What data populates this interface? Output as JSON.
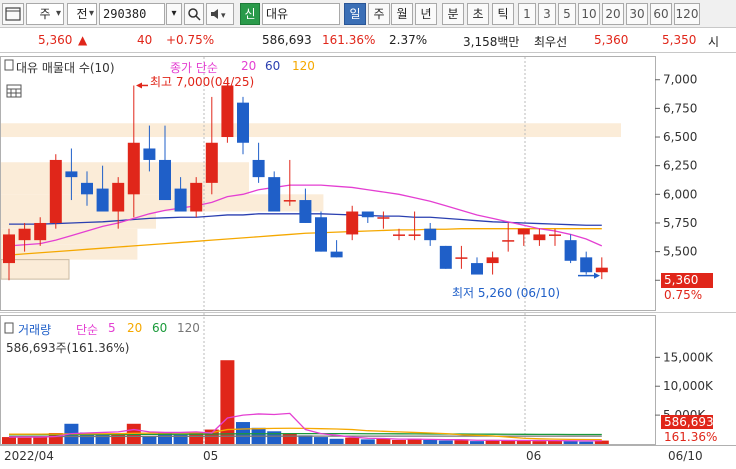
{
  "toolbar": {
    "type_label": "주",
    "market_label": "전",
    "code_value": "290380",
    "signal_badge": "신",
    "stock_name": "대유",
    "period_tabs": [
      "일",
      "주",
      "월",
      "년",
      "분",
      "초",
      "틱"
    ],
    "active_period": "일",
    "interval_buttons": [
      "1",
      "3",
      "5",
      "10",
      "20",
      "30",
      "60",
      "120"
    ]
  },
  "quote": {
    "price": "5,360",
    "change": "40",
    "change_pct": "+0.75%",
    "volume": "586,693",
    "volume_ratio": "161.36%",
    "turnover": "2.37%",
    "amount": "3,158백만",
    "ask_label": "최우선",
    "ask_price": "5,360",
    "bid_price": "5,350",
    "extra": "시"
  },
  "price_panel": {
    "title": "대유 매물대 수(10)",
    "ma_label": "종가 단순",
    "ma_periods": [
      "20",
      "60",
      "120"
    ],
    "high_annotation": "최고 7,000(04/25)",
    "low_annotation": "최저 5,260 (06/10)",
    "current_price_tag": "5,360",
    "current_pct_tag": "0.75%",
    "y_ticks": [
      "7,000",
      "6,750",
      "6,500",
      "6,250",
      "6,000",
      "5,750",
      "5,500",
      "5,250"
    ]
  },
  "volume_panel": {
    "title": "거래량",
    "ma_label": "단순",
    "ma_periods": [
      "5",
      "20",
      "60",
      "120"
    ],
    "summary": "586,693주(161.36%)",
    "current_volume_tag": "586,693",
    "current_pct_tag": "161.36%",
    "y_ticks": [
      "15,000K",
      "10,000K",
      "5,000K"
    ]
  },
  "xaxis": {
    "labels": [
      "2022/04",
      "05",
      "06",
      "06/10"
    ]
  },
  "chart_data": {
    "type": "candlestick",
    "candles": [
      {
        "o": 5400,
        "h": 5700,
        "l": 5250,
        "c": 5650
      },
      {
        "o": 5600,
        "h": 5750,
        "l": 5500,
        "c": 5700
      },
      {
        "o": 5600,
        "h": 5800,
        "l": 5550,
        "c": 5750
      },
      {
        "o": 5750,
        "h": 6350,
        "l": 5700,
        "c": 6300
      },
      {
        "o": 6200,
        "h": 6400,
        "l": 5950,
        "c": 6150
      },
      {
        "o": 6100,
        "h": 6200,
        "l": 5900,
        "c": 6000
      },
      {
        "o": 6050,
        "h": 6250,
        "l": 5850,
        "c": 5850
      },
      {
        "o": 5850,
        "h": 6150,
        "l": 5700,
        "c": 6100
      },
      {
        "o": 6000,
        "h": 6950,
        "l": 5800,
        "c": 6450
      },
      {
        "o": 6400,
        "h": 6600,
        "l": 6200,
        "c": 6300
      },
      {
        "o": 6300,
        "h": 6600,
        "l": 6000,
        "c": 5950
      },
      {
        "o": 6050,
        "h": 6150,
        "l": 5850,
        "c": 5850
      },
      {
        "o": 5850,
        "h": 6150,
        "l": 5800,
        "c": 6100
      },
      {
        "o": 6100,
        "h": 6850,
        "l": 6000,
        "c": 6450
      },
      {
        "o": 6500,
        "h": 7000,
        "l": 6450,
        "c": 6950
      },
      {
        "o": 6800,
        "h": 6850,
        "l": 6350,
        "c": 6450
      },
      {
        "o": 6300,
        "h": 6450,
        "l": 6100,
        "c": 6150
      },
      {
        "o": 6150,
        "h": 6200,
        "l": 5850,
        "c": 5850
      },
      {
        "o": 5950,
        "h": 6300,
        "l": 5900,
        "c": 5950
      },
      {
        "o": 5950,
        "h": 6050,
        "l": 5750,
        "c": 5750
      },
      {
        "o": 5800,
        "h": 5850,
        "l": 5500,
        "c": 5500
      },
      {
        "o": 5500,
        "h": 5600,
        "l": 5450,
        "c": 5450
      },
      {
        "o": 5650,
        "h": 5900,
        "l": 5600,
        "c": 5850
      },
      {
        "o": 5850,
        "h": 5850,
        "l": 5750,
        "c": 5800
      },
      {
        "o": 5800,
        "h": 5850,
        "l": 5700,
        "c": 5800
      },
      {
        "o": 5650,
        "h": 5700,
        "l": 5600,
        "c": 5650
      },
      {
        "o": 5650,
        "h": 5850,
        "l": 5600,
        "c": 5650
      },
      {
        "o": 5700,
        "h": 5750,
        "l": 5550,
        "c": 5600
      },
      {
        "o": 5550,
        "h": 5550,
        "l": 5350,
        "c": 5350
      },
      {
        "o": 5450,
        "h": 5550,
        "l": 5350,
        "c": 5450
      },
      {
        "o": 5400,
        "h": 5450,
        "l": 5300,
        "c": 5300
      },
      {
        "o": 5400,
        "h": 5500,
        "l": 5300,
        "c": 5450
      },
      {
        "o": 5600,
        "h": 5750,
        "l": 5500,
        "c": 5600
      },
      {
        "o": 5650,
        "h": 5700,
        "l": 5550,
        "c": 5700
      },
      {
        "o": 5600,
        "h": 5700,
        "l": 5550,
        "c": 5650
      },
      {
        "o": 5650,
        "h": 5700,
        "l": 5550,
        "c": 5650
      },
      {
        "o": 5600,
        "h": 5650,
        "l": 5400,
        "c": 5420
      },
      {
        "o": 5450,
        "h": 5500,
        "l": 5300,
        "c": 5320
      },
      {
        "o": 5320,
        "h": 5450,
        "l": 5260,
        "c": 5360
      }
    ],
    "ma20": [
      5550,
      5560,
      5570,
      5600,
      5640,
      5680,
      5720,
      5750,
      5790,
      5830,
      5860,
      5880,
      5900,
      5930,
      5980,
      6000,
      6040,
      6060,
      6080,
      6080,
      6080,
      6070,
      6060,
      6040,
      6020,
      6000,
      5970,
      5940,
      5900,
      5860,
      5820,
      5790,
      5760,
      5730,
      5700,
      5680,
      5650,
      5610,
      5550
    ],
    "ma60": [
      5740,
      5740,
      5740,
      5745,
      5750,
      5755,
      5760,
      5770,
      5780,
      5790,
      5795,
      5800,
      5800,
      5810,
      5820,
      5820,
      5830,
      5830,
      5830,
      5830,
      5830,
      5825,
      5820,
      5815,
      5810,
      5810,
      5800,
      5800,
      5790,
      5780,
      5770,
      5760,
      5755,
      5750,
      5745,
      5740,
      5735,
      5730,
      5730
    ],
    "ma120": [
      5470,
      5480,
      5490,
      5500,
      5510,
      5520,
      5530,
      5540,
      5550,
      5560,
      5570,
      5580,
      5590,
      5600,
      5610,
      5620,
      5630,
      5640,
      5650,
      5660,
      5665,
      5670,
      5675,
      5680,
      5685,
      5690,
      5690,
      5695,
      5695,
      5700,
      5700,
      5700,
      5700,
      5700,
      5700,
      5700,
      5700,
      5700,
      5700
    ],
    "volume": [
      1200,
      1100,
      1300,
      1900,
      3500,
      2000,
      1700,
      1800,
      3500,
      1400,
      2000,
      1600,
      1900,
      2500,
      14500,
      3800,
      2800,
      2200,
      1800,
      1500,
      1200,
      900,
      1100,
      800,
      900,
      700,
      900,
      700,
      600,
      800,
      500,
      700,
      600,
      700,
      500,
      600,
      500,
      400,
      587
    ],
    "volume_ma5": [
      1200,
      1200,
      1200,
      1300,
      1800,
      1900,
      2000,
      2100,
      2500,
      2100,
      2000,
      2000,
      2100,
      1900,
      4500,
      5000,
      5200,
      5100,
      5300,
      2500,
      1800,
      1500,
      1200,
      1000,
      950,
      850,
      850,
      800,
      750,
      750,
      650,
      650,
      620,
      600,
      600,
      580,
      560,
      540,
      560
    ],
    "volume_ma20": [
      1700,
      1700,
      1710,
      1720,
      1750,
      1760,
      1780,
      1800,
      1850,
      1880,
      1900,
      1920,
      1950,
      1980,
      2500,
      2600,
      2650,
      2700,
      2720,
      2700,
      2650,
      2600,
      2500,
      2300,
      2200,
      2100,
      2000,
      1900,
      1800,
      1600,
      1500,
      1400,
      1200,
      1000,
      900,
      850,
      800,
      780,
      760
    ],
    "volume_ma60": [
      1600,
      1600,
      1610,
      1610,
      1620,
      1630,
      1640,
      1650,
      1660,
      1670,
      1680,
      1690,
      1700,
      1710,
      1750,
      1760,
      1770,
      1780,
      1790,
      1800,
      1800,
      1800,
      1790,
      1780,
      1770,
      1760,
      1750,
      1740,
      1730,
      1720,
      1710,
      1700,
      1690,
      1680,
      1670,
      1660,
      1650,
      1640,
      1640
    ],
    "volume_ma120": [
      1300,
      1300,
      1300,
      1300,
      1310,
      1310,
      1310,
      1320,
      1320,
      1320,
      1330,
      1330,
      1330,
      1340,
      1340,
      1350,
      1350,
      1350,
      1360,
      1360,
      1360,
      1360,
      1360,
      1360,
      1360,
      1360,
      1360,
      1360,
      1360,
      1360,
      1360,
      1360,
      1360,
      1360,
      1360,
      1360,
      1360,
      1360,
      1360
    ],
    "price_ylim": [
      5200,
      7050
    ],
    "volume_ylim": [
      0,
      18000
    ],
    "volume_profile": [
      {
        "from": 6500,
        "to": 6620,
        "weight": 1.0
      },
      {
        "from": 6280,
        "to": 6500,
        "weight": 0.0
      },
      {
        "from": 6000,
        "to": 6280,
        "weight": 0.4
      },
      {
        "from": 5850,
        "to": 6000,
        "weight": 0.52
      },
      {
        "from": 5700,
        "to": 5850,
        "weight": 0.25
      },
      {
        "from": 5560,
        "to": 5700,
        "weight": 0.22
      },
      {
        "from": 5430,
        "to": 5560,
        "weight": 0.22
      },
      {
        "from": 5260,
        "to": 5430,
        "weight": 0.11
      }
    ],
    "colors": {
      "up": "#e0261a",
      "down": "#1f5fc8",
      "ma20": "#e43fd2",
      "ma60": "#2a3fb0",
      "ma120": "#f5a800",
      "vma5": "#e43fd2",
      "vma20": "#f5a800",
      "vma60": "#1a9a3a",
      "vma120": "#777777",
      "profile": "#fbecd8"
    }
  }
}
